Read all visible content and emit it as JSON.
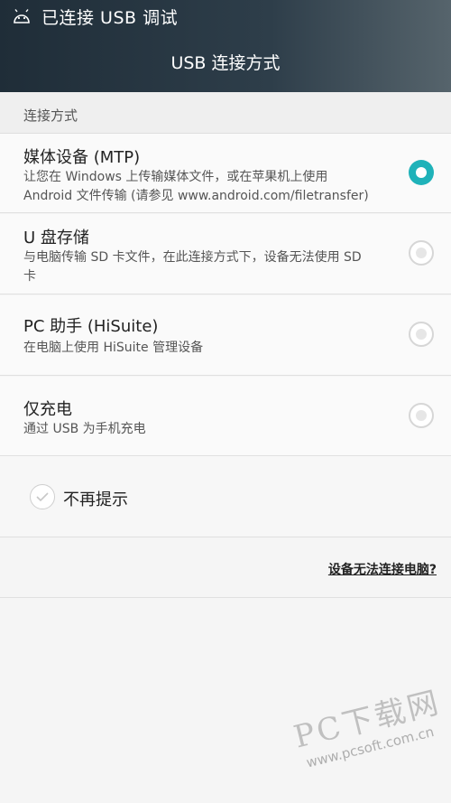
{
  "status_bar": {
    "icon": "android-icon",
    "text": "已连接 USB 调试"
  },
  "header": {
    "title": "USB 连接方式"
  },
  "section": {
    "label": "连接方式"
  },
  "options": [
    {
      "title": "媒体设备 (MTP)",
      "desc_line1": "让您在 Windows 上传输媒体文件，或在苹果机上使用",
      "desc_line2": "Android 文件传输 (请参见 www.android.com/filetransfer)",
      "selected": true
    },
    {
      "title": "U 盘存储",
      "desc_line1": "与电脑传输 SD 卡文件，在此连接方式下，设备无法使用 SD",
      "desc_line2": "卡",
      "selected": false
    },
    {
      "title": "PC 助手 (HiSuite)",
      "desc_line1": "在电脑上使用 HiSuite 管理设备",
      "selected": false
    },
    {
      "title": "仅充电",
      "desc_line1": "通过 USB 为手机充电",
      "selected": false
    }
  ],
  "dont_show": {
    "label": "不再提示",
    "checked": false
  },
  "help": {
    "link": "设备无法连接电脑?"
  },
  "watermark": {
    "main": "PC下载网",
    "url": "www.pcsoft.com.cn"
  },
  "colors": {
    "accent": "#1fb2b9",
    "topbar": "#2e3e4a"
  }
}
